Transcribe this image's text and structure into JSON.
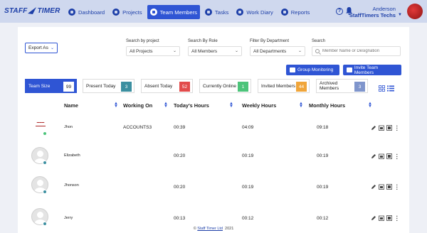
{
  "brand": {
    "name_part1": "STAFF",
    "name_part2": "TIMER"
  },
  "nav": [
    {
      "label": "Dashboard",
      "icon": "dashboard-icon"
    },
    {
      "label": "Projects",
      "icon": "projects-icon"
    },
    {
      "label": "Team Members",
      "icon": "team-icon",
      "active": true
    },
    {
      "label": "Tasks",
      "icon": "tasks-icon"
    },
    {
      "label": "Work Diary",
      "icon": "diary-icon"
    },
    {
      "label": "Reports",
      "icon": "reports-icon"
    }
  ],
  "user": {
    "name": "Anderson",
    "org": "StaffTimers Techs"
  },
  "toolbar": {
    "export_label": "Export As",
    "project_label": "Search by project",
    "project_value": "All Projects",
    "role_label": "Search By Role",
    "role_value": "All Members",
    "dept_label": "Filter By Department",
    "dept_value": "All Departments",
    "search_label": "Search",
    "search_placeholder": "Member Name or Designation",
    "group_monitoring": "Group Monitoring",
    "invite_members": "Invite Team Members"
  },
  "stats": [
    {
      "label": "Team Size",
      "value": "99",
      "color": "#ffffff"
    },
    {
      "label": "Present Today",
      "value": "3",
      "color": "#3b8fa0"
    },
    {
      "label": "Absent Today",
      "value": "52",
      "color": "#e24b4b"
    },
    {
      "label": "Currently Online",
      "value": "1",
      "color": "#4cc47a"
    },
    {
      "label": "Invited Members",
      "value": "44",
      "color": "#f0a53a"
    },
    {
      "label": "Archived Members",
      "value": "3",
      "color": "#7f95cc"
    }
  ],
  "table": {
    "headers": [
      "Name",
      "Working On",
      "Today's Hours",
      "Weekly Hours",
      "Monthly Hours"
    ],
    "rows": [
      {
        "name": "Jhon",
        "working_on": "ACCOUNTS3",
        "today": "00:39",
        "weekly": "04:09",
        "monthly": "09:18",
        "status_color": "#4cc47a",
        "logo_avatar": true
      },
      {
        "name": "Elizabeth",
        "working_on": "",
        "today": "00:20",
        "weekly": "00:19",
        "monthly": "00:19",
        "status_color": "#3b8fa0"
      },
      {
        "name": "Jhonson",
        "working_on": "",
        "today": "00:20",
        "weekly": "00:19",
        "monthly": "00:19",
        "status_color": "#3b8fa0"
      },
      {
        "name": "Jerry",
        "working_on": "",
        "today": "00:13",
        "weekly": "00:12",
        "monthly": "00:12",
        "status_color": "#3b8fa0"
      }
    ]
  },
  "footer": {
    "prefix": "© ",
    "company": "Staff Timer Ltd",
    "year": "2021"
  }
}
